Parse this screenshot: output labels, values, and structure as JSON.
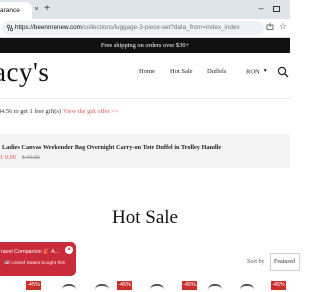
{
  "browser": {
    "tab_title": "arance",
    "tab_close": "×",
    "new_tab": "+",
    "minimize": "–",
    "url_host": "https://beennrenew.com",
    "url_path": "/collections/luggage-3-piece-set?data_from=index_index",
    "bookmark": "☆"
  },
  "announcement": "Free shipping on orders over $30+",
  "header": {
    "logo": "acy's",
    "nav": {
      "home": "Home",
      "hot_sale": "Hot Sale",
      "duffels": "Duffels",
      "currency": "RON"
    }
  },
  "gift": {
    "text": "84.56 to get 1 free gift(s)",
    "link": "View the gift offer >>",
    "product_name": "Ladies Canvas Weekender Bag Overnight Carry-on Tote Duffel in Trolley Handle",
    "price": "1 0.00",
    "compare_price": "$ 99.85"
  },
  "section": {
    "title": "Hot Sale",
    "sort_label": "Sort by",
    "sort_value": "Featured"
  },
  "badges": [
    "-45%",
    "-45%",
    "-45%",
    "-45%"
  ],
  "popup": {
    "title": "ravel Companion 🎒 A...",
    "subtitle": "🇺🇸 United States bought this",
    "close": "×"
  },
  "colors": {
    "accent": "#d9534f",
    "badge": "#c9302c",
    "popup": "#c92b3a",
    "announcement_bg": "#111111"
  }
}
